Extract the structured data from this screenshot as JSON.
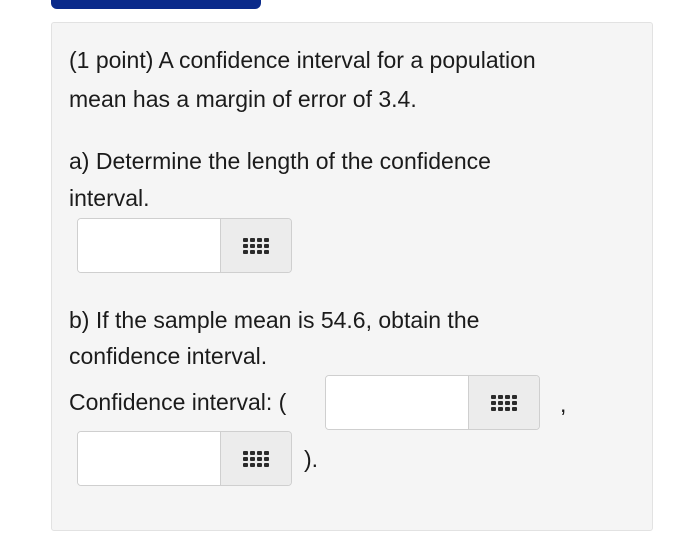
{
  "question": {
    "intro_line1": "(1 point) A confidence interval for a population",
    "intro_line2": "mean has a margin of error of 3.4.",
    "part_a_line1": "a) Determine the length of the confidence",
    "part_a_line2": "interval.",
    "part_b_line1": "b) If the sample mean is 54.6, obtain the",
    "part_b_line2": "confidence interval.",
    "ci_label": "Confidence interval: (",
    "comma": ",",
    "close_paren": ")."
  },
  "answers": {
    "length_value": "",
    "lower_value": "",
    "upper_value": ""
  },
  "icons": {
    "palette": "equation-palette-icon"
  }
}
